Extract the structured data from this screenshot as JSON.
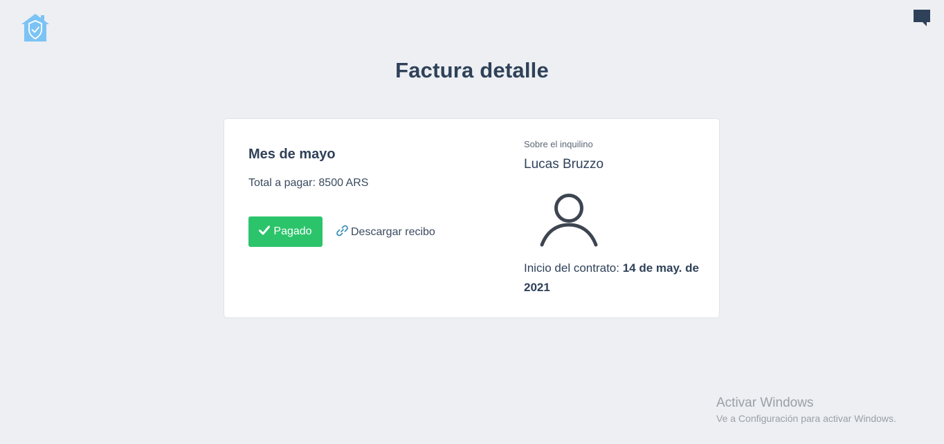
{
  "header": {
    "logo_icon": "house-shield-icon",
    "chat_icon": "chat-bubble-icon"
  },
  "page": {
    "title": "Factura detalle"
  },
  "invoice": {
    "month_title": "Mes de mayo",
    "total_text": "Total a pagar: 8500 ARS",
    "paid_button_label": "Pagado",
    "paid_icon": "check-icon",
    "download_label": "Descargar recibo",
    "download_icon": "link-icon"
  },
  "tenant": {
    "caption": "Sobre el inquilino",
    "name": "Lucas Bruzzo",
    "avatar_icon": "user-avatar-icon",
    "contract_label": "Inicio del contrato:",
    "contract_date": "14 de may. de 2021"
  },
  "watermark": {
    "title": "Activar Windows",
    "subtitle": "Ve a Configuración para activar Windows."
  },
  "colors": {
    "background": "#edeff2",
    "accent_green": "#2cc46b",
    "logo_blue": "#7cc3f5",
    "title_text": "#2f4159",
    "chat_icon": "#2f4159"
  }
}
